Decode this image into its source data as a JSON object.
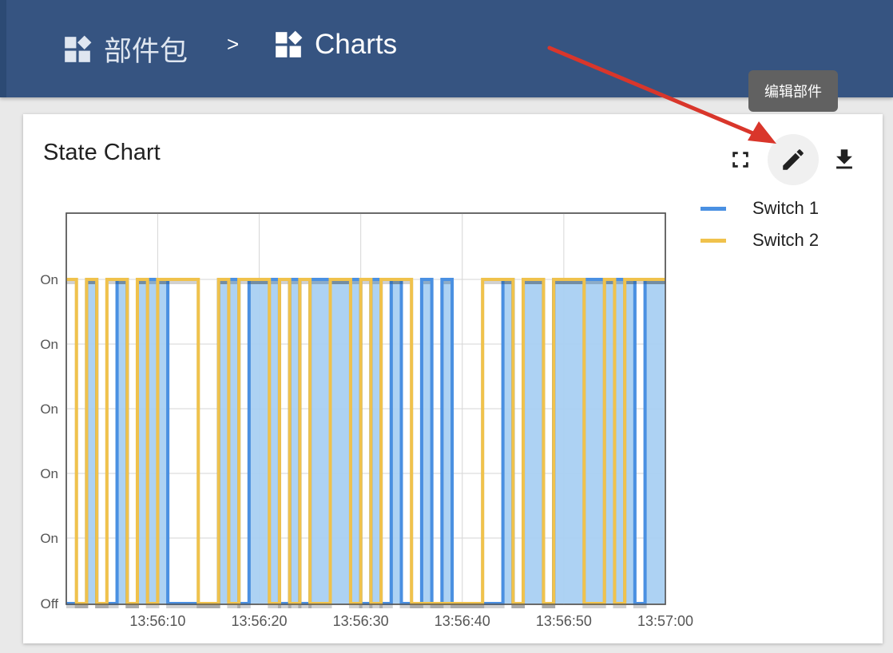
{
  "breadcrumb": {
    "home_label": "部件包",
    "separator": ">",
    "current_label": "Charts"
  },
  "card": {
    "title": "State Chart",
    "tooltip": "编辑部件",
    "actions": {
      "fullscreen_icon": "fullscreen-icon",
      "edit_icon": "pencil-icon",
      "download_icon": "download-icon"
    }
  },
  "colors": {
    "topbar": "#365481",
    "switch1": "#4a90e2",
    "switch1_fill": "#a9d0f2",
    "switch2": "#f0c24c",
    "arrow": "#d9362b"
  },
  "chart_data": {
    "type": "line",
    "title": "State Chart",
    "x_tick_labels": [
      "13:56:10",
      "13:56:20",
      "13:56:30",
      "13:56:40",
      "13:56:50",
      "13:57:00"
    ],
    "y_tick_labels": [
      "On",
      "On",
      "On",
      "On",
      "On",
      "Off"
    ],
    "x_range": [
      "13:56:01",
      "13:57:00"
    ],
    "y_range": [
      0,
      1
    ],
    "grid": true,
    "legend_position": "right",
    "series": [
      {
        "name": "Switch 1",
        "step": true,
        "filled": true,
        "x": [
          1,
          2,
          3,
          4,
          5,
          6,
          7,
          8,
          9,
          10,
          11,
          12,
          13,
          14,
          15,
          16,
          17,
          18,
          19,
          20,
          21,
          22,
          23,
          24,
          25,
          26,
          27,
          28,
          29,
          30,
          31,
          32,
          33,
          34,
          35,
          36,
          37,
          38,
          39,
          40,
          41,
          42,
          43,
          44,
          45,
          46,
          47,
          48,
          49,
          50,
          51,
          52,
          53,
          54,
          55,
          56,
          57,
          58,
          59
        ],
        "values": [
          0,
          0,
          1,
          0,
          0,
          1,
          0,
          1,
          1,
          1,
          0,
          0,
          0,
          0,
          0,
          1,
          1,
          0,
          1,
          1,
          1,
          0,
          1,
          0,
          1,
          1,
          1,
          1,
          1,
          0,
          1,
          0,
          1,
          0,
          0,
          1,
          0,
          1,
          0,
          0,
          0,
          0,
          0,
          1,
          0,
          1,
          1,
          0,
          1,
          1,
          1,
          1,
          1,
          1,
          1,
          1,
          0,
          1,
          1
        ]
      },
      {
        "name": "Switch 2",
        "step": true,
        "filled": false,
        "x": [
          1,
          2,
          3,
          4,
          5,
          6,
          7,
          8,
          9,
          10,
          11,
          12,
          13,
          14,
          15,
          16,
          17,
          18,
          19,
          20,
          21,
          22,
          23,
          24,
          25,
          26,
          27,
          28,
          29,
          30,
          31,
          32,
          33,
          34,
          35,
          36,
          37,
          38,
          39,
          40,
          41,
          42,
          43,
          44,
          45,
          46,
          47,
          48,
          49,
          50,
          51,
          52,
          53,
          54,
          55,
          56,
          57,
          58,
          59
        ],
        "values": [
          1,
          0,
          1,
          0,
          1,
          1,
          0,
          1,
          0,
          1,
          1,
          1,
          1,
          0,
          0,
          1,
          0,
          1,
          1,
          1,
          0,
          1,
          0,
          1,
          0,
          0,
          1,
          1,
          0,
          1,
          0,
          1,
          1,
          1,
          0,
          0,
          0,
          0,
          0,
          0,
          0,
          1,
          1,
          1,
          0,
          1,
          1,
          0,
          1,
          1,
          1,
          0,
          0,
          1,
          0,
          1,
          1,
          1,
          1
        ]
      }
    ]
  }
}
